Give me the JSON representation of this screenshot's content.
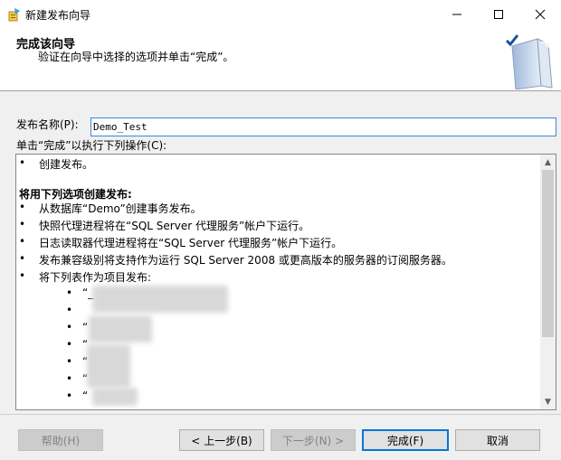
{
  "window": {
    "title": "新建发布向导",
    "minimize_glyph": "—",
    "maximize_glyph": "☐",
    "close_glyph": "✕"
  },
  "header": {
    "title": "完成该向导",
    "subtitle": "验证在向导中选择的选项并单击“完成”。"
  },
  "form": {
    "name_label": "发布名称(P):",
    "name_value": "Demo_Test",
    "ops_label": "单击“完成”以执行下列操作(C):"
  },
  "operations": {
    "bullet": "•",
    "lines": [
      "创建发布。",
      "将用下列选项创建发布:",
      "从数据库“Demo”创建事务发布。",
      "快照代理进程将在“SQL Server 代理服务”帐户下运行。",
      "日志读取器代理进程将在“SQL Server 代理服务”帐户下运行。",
      "发布兼容级别将支持作为运行 SQL Server 2008 或更高版本的服务器的订阅服务器。",
      "将下列表作为项目发布:"
    ],
    "sub_items": [
      "“_",
      "",
      "“",
      "“",
      "“",
      "“",
      "“"
    ],
    "scroll_up": "▲",
    "scroll_down": "▼"
  },
  "footer": {
    "help": "帮助(H)",
    "back": "< 上一步(B)",
    "next": "下一步(N) >",
    "finish": "完成(F)",
    "cancel": "取消"
  },
  "colors": {
    "accent": "#0078d7",
    "panel": "#f0f0f0"
  }
}
